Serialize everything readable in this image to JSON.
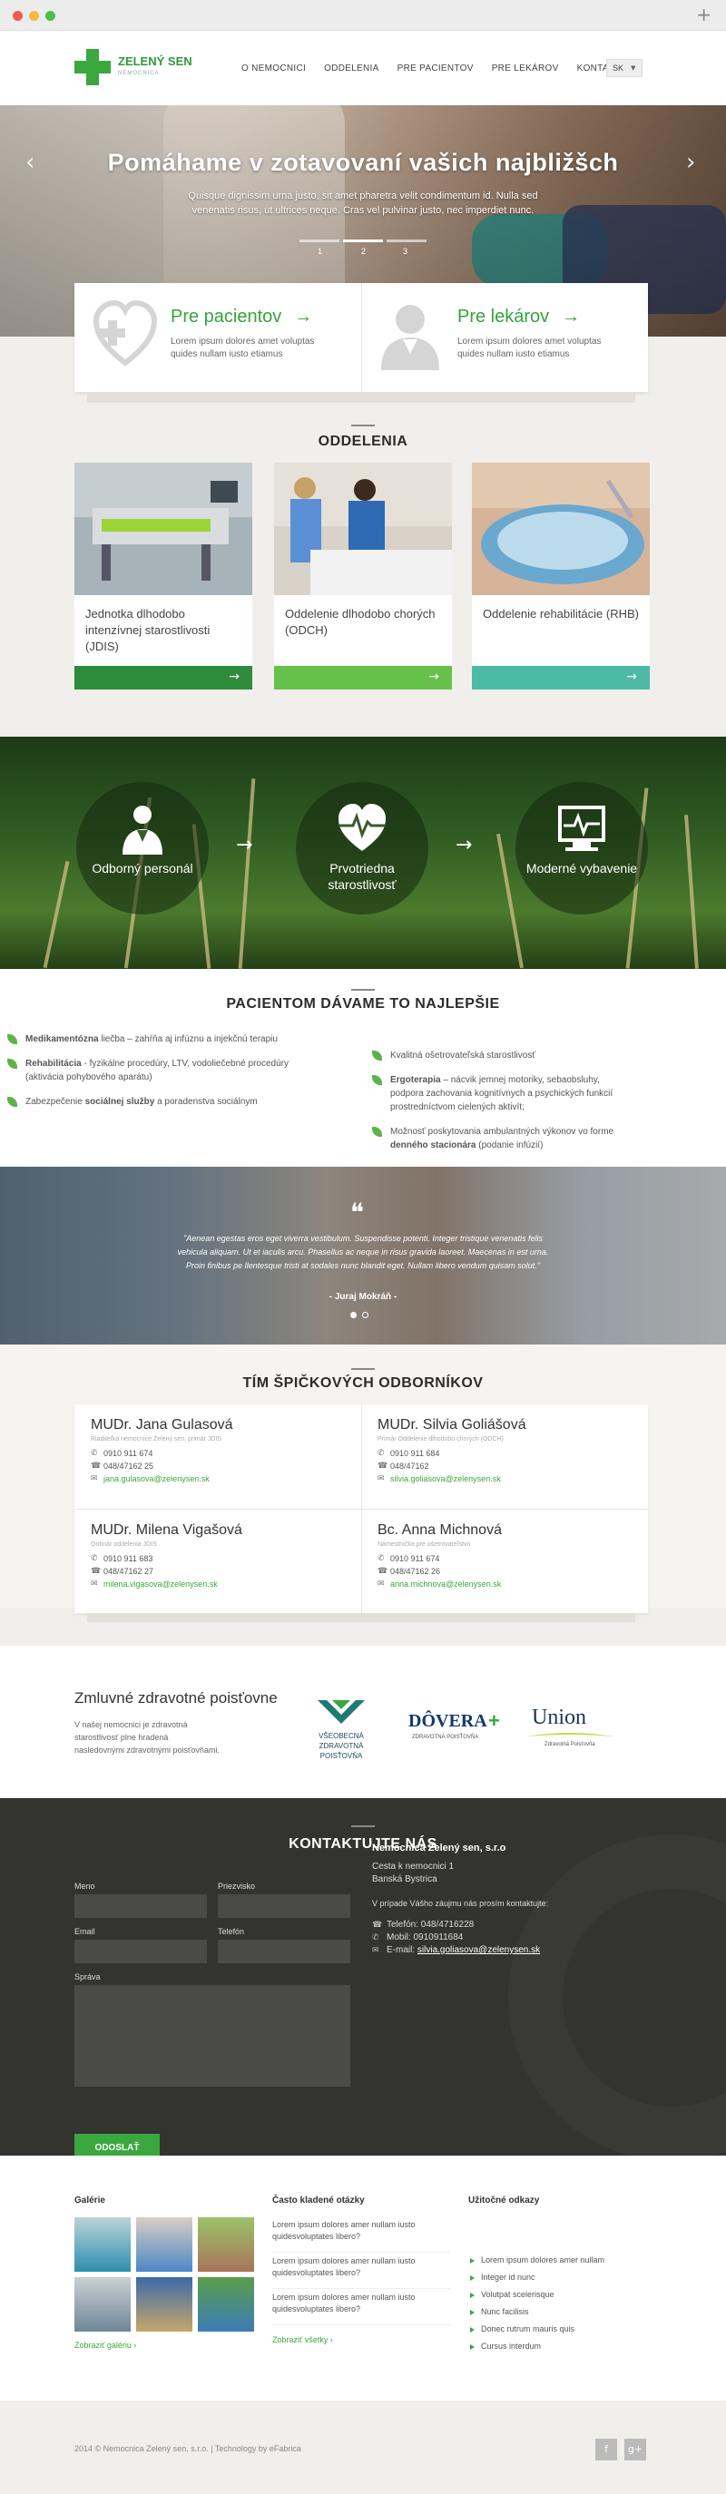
{
  "browser": {
    "plus_icon": "+"
  },
  "header": {
    "logo_name": "ZELENÝ SEN",
    "logo_sub": "NEMOCNICA",
    "nav": [
      "O NEMOCNICI",
      "ODDELENIA",
      "PRE PACIENTOV",
      "PRE LEKÁROV",
      "KONTAKTY"
    ],
    "lang": "SK"
  },
  "hero": {
    "title": "Pomáhame v zotavovaní vašich najbližšch",
    "text": "Quisque dignissim urna justo, sit amet pharetra velit condimentum id. Nulla sed venenatis risus, ut ultrices neque. Cras vel pulvinar justo, nec imperdiet nunc.",
    "prev": "‹",
    "next": "›",
    "slides": [
      "1",
      "2",
      "3"
    ],
    "active_slide": 2
  },
  "cards": [
    {
      "title": "Pre pacientov",
      "arrow": "→",
      "text": "Lorem ipsum dolores amet voluptas quides nullam iusto etiamus",
      "icon": "heart-plus-icon"
    },
    {
      "title": "Pre lekárov",
      "arrow": "→",
      "text": "Lorem ipsum dolores amet voluptas quides nullam iusto etiamus",
      "icon": "doctor-icon"
    }
  ],
  "departments": {
    "title": "ODDELENIA",
    "items": [
      {
        "name": "Jednotka dlhodobo intenzívnej starostlivosti (JDIS)",
        "color": "#2e8b3b",
        "arrow": "→"
      },
      {
        "name": "Oddelenie dlhodobo chorých (ODCH)",
        "color": "#66c14a",
        "arrow": "→"
      },
      {
        "name": "Oddelenie rehabilitácie (RHB)",
        "color": "#4cbaa5",
        "arrow": "→"
      }
    ]
  },
  "features": {
    "items": [
      {
        "label": "Odborný personál",
        "icon": "doctor-icon"
      },
      {
        "label": "Prvotriedna starostlivosť",
        "icon": "heartbeat-icon"
      },
      {
        "label": "Moderné vybavenie",
        "icon": "monitor-icon"
      }
    ],
    "arrow": "→"
  },
  "care": {
    "title": "PACIENTOM DÁVAME TO NAJLEPŠIE",
    "left": [
      {
        "bold": "Medikamentózna",
        "text": " liečba – zahŕňa aj infúznu a injekčnú terapiu"
      },
      {
        "bold": "Rehabilitácia",
        "text": " - fyzikálne procedúry, LTV, vodoliečebné procedúry (aktivácia pohybového aparátu)"
      },
      {
        "pre": "Zabezpečenie ",
        "bold": "sociálnej služby",
        "text": " a poradenstva sociálnym"
      }
    ],
    "right": [
      {
        "text": "Kvalitná ošetrovateľská starostlivosť"
      },
      {
        "bold": "Ergoterapia",
        "text": " – nácvik jemnej motoriky, sebaobsluhy, podpora zachovania kognitívnych a psychických funkcií prostredníctvom cielených aktivít;"
      },
      {
        "pre": "Možnosť poskytovania ambulantných výkonov vo forme ",
        "bold": "denného stacionára",
        "text": " (podanie infúzií)"
      }
    ]
  },
  "testimonial": {
    "quote_mark": "❝",
    "text": "\"Aenean egestas eros eget viverra vestibulum. Suspendisse potenti. Integer tristique venenatis felis vehicula aliquam. Ut et iaculis arcu. Phasellus ac neque in risus gravida laoreet. Maecenas in est urna. Proin finibus pe llentesque tristi at sodales nunc blandit eget. Nullam libero vendum quisam solut.\"",
    "author": "- Juraj Mokráň -"
  },
  "team": {
    "title": "TÍM ŠPIČKOVÝCH ODBORNÍKOV",
    "doctors": [
      {
        "name": "MUDr. Jana Gulasová",
        "role": "Riaditeľka nemocnice Zelený sen, primár JDIS",
        "mobile": "0910 911 674",
        "phone": "048/47162 25",
        "email": "jana.gulasova@zelenysen.sk"
      },
      {
        "name": "MUDr. Silvia Goliášová",
        "role": "Primár Oddelenie dlhodobo chorých (ODCH)",
        "mobile": "0910 911 684",
        "phone": "048/47162",
        "email": "silvia.goliasova@zelenysen.sk"
      },
      {
        "name": "MUDr. Milena Vigašová",
        "role": "Ordinár oddelenia JDIS",
        "mobile": "0910 911 683",
        "phone": "048/47162 27",
        "email": "milena.vigasova@zelenysen.sk"
      },
      {
        "name": "Bc. Anna Michnová",
        "role": "Námestníčka pre ošetrovateľstvo",
        "mobile": "0910 911 674",
        "phone": "048/47162 26",
        "email": "anna.michnova@zelenysen.sk"
      }
    ]
  },
  "insurance": {
    "title": "Zmluvné zdravotné poisťovne",
    "text": "V našej nemocnici je zdravotná starostlivosť plne hradená nasledovnými zdravotnými poisťovňami.",
    "logos": [
      {
        "name": "VŠEOBECNÁ ZDRAVOTNÁ POISŤOVŇA",
        "color": "#1f7a73"
      },
      {
        "name": "DÔVERA",
        "sub": "ZDRAVOTNÁ POISŤOVŇA",
        "color": "#123a6e",
        "accent": "#3aa83f"
      },
      {
        "name": "Union",
        "sub": "Zdravotná Poisťovňa",
        "color": "#1b3556",
        "accent": "#c8d64a"
      }
    ]
  },
  "contact": {
    "title": "KONTAKTUJTE NÁS",
    "labels": {
      "name": "Meno",
      "surname": "Priezvisko",
      "email": "Email",
      "phone": "Telefón",
      "message": "Správa"
    },
    "send": "ODOSLAŤ",
    "company": "Nemocnica Zelený sen, s.r.o",
    "street": "Cesta k nemocnici 1",
    "city": "Banská Bystrica",
    "note": "V prípade Vášho záujmu nás prosím kontaktujte:",
    "phone": "Telefón: 048/4716228",
    "mobile": "Mobil: 0910911684",
    "email_label": "E-mail: ",
    "email": "silvia.goliasova@zelenysen.sk"
  },
  "footer": {
    "gallery_title": "Galérie",
    "gallery_link": "Zobraziť galériu",
    "faq_title": "Často kladené otázky",
    "faq": [
      "Lorem ipsum dolores amer nullam iusto quidesvoluptates libero?",
      "Lorem ipsum dolores amer nullam iusto quidesvoluptates libero?",
      "Lorem ipsum dolores amer nullam iusto quidesvoluptates libero?"
    ],
    "faq_link": "Zobraziť všetky",
    "links_title": "Užitočné odkazy",
    "links": [
      "Lorem ipsum dolores amer nullam",
      "Integer id nunc",
      "Volutpat scelerisque",
      "Nunc facilisis",
      "Donec rutrum mauris quis",
      "Cursus interdum"
    ],
    "link_arrow": "›"
  },
  "copyright": {
    "text": "2014 © Nemocnica Zelený sen, s.r.o.  |  Technology by eFabrica",
    "social": [
      "f",
      "g+"
    ]
  }
}
